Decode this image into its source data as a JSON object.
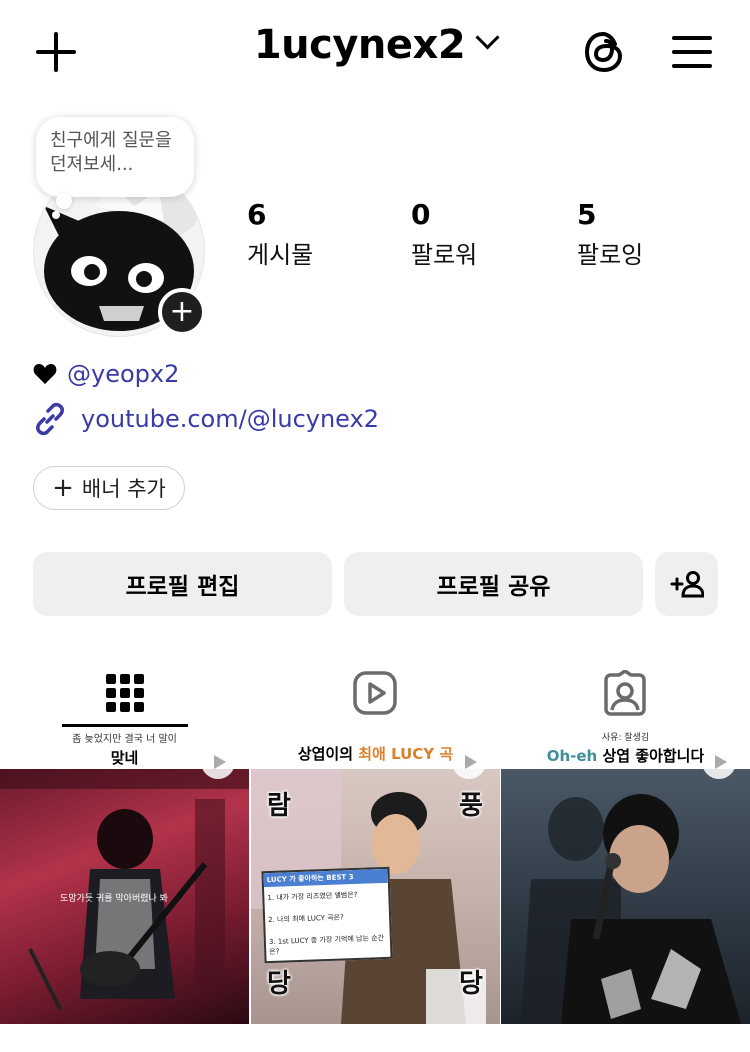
{
  "header": {
    "username": "1ucynex2"
  },
  "profile": {
    "note": "친구에게 질문을 던져보세...",
    "stats": [
      {
        "count": "6",
        "label": "게시물"
      },
      {
        "count": "0",
        "label": "팔로워"
      },
      {
        "count": "5",
        "label": "팔로잉"
      }
    ],
    "bio_mention": "@yeopx2",
    "link": "youtube.com/@lucynex2",
    "banner_button": "배너 추가"
  },
  "actions": {
    "edit_profile": "프로필 편집",
    "share_profile": "프로필 공유"
  },
  "tabs": [
    "grid-icon",
    "reels-icon",
    "tagged-icon"
  ],
  "posts": [
    {
      "caption_small": "좀 늦었지만 결국 너 말이",
      "caption_title": "맞네",
      "overlay_text": "도망가듯 귀를 막아버렸나 봐"
    },
    {
      "caption_title_prefix": "상엽이의 ",
      "caption_title_accent": "최애 LUCY 곡",
      "corners": [
        "람",
        "풍",
        "당",
        "당"
      ],
      "board_header": "LUCY 가 좋아하는 BEST 3",
      "board_lines": [
        "1. 내가 가장 리즈였던 앨범은?",
        "2. 나의 최애 LUCY 곡은?",
        "3. 1st LUCY 중 가장 기억에 남는 순간은?"
      ]
    },
    {
      "caption_small": "사유: 잘생김",
      "caption_title_accent": "Oh-eh",
      "caption_title_rest": " 상엽 좋아합니다"
    }
  ],
  "colors": {
    "link": "#3a3aa8",
    "button_bg": "#efefef",
    "accent_teal": "#3f8f9a",
    "accent_orange": "#d9822b"
  }
}
